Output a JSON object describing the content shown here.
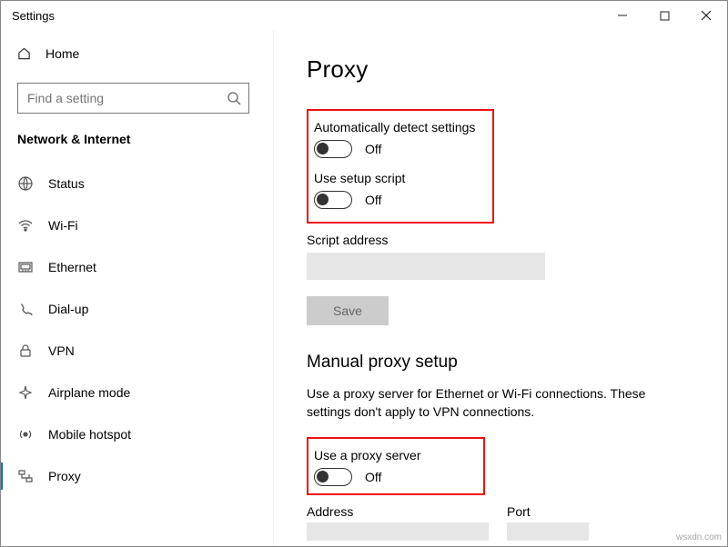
{
  "window": {
    "title": "Settings"
  },
  "sidebar": {
    "home": "Home",
    "search_placeholder": "Find a setting",
    "header": "Network & Internet",
    "items": [
      {
        "label": "Status"
      },
      {
        "label": "Wi-Fi"
      },
      {
        "label": "Ethernet"
      },
      {
        "label": "Dial-up"
      },
      {
        "label": "VPN"
      },
      {
        "label": "Airplane mode"
      },
      {
        "label": "Mobile hotspot"
      },
      {
        "label": "Proxy"
      }
    ]
  },
  "page": {
    "title": "Proxy",
    "auto_label": "Automatically detect settings",
    "auto_state": "Off",
    "script_label": "Use setup script",
    "script_state": "Off",
    "script_addr_label": "Script address",
    "save": "Save",
    "manual_title": "Manual proxy setup",
    "manual_desc": "Use a proxy server for Ethernet or Wi-Fi connections. These settings don't apply to VPN connections.",
    "use_proxy_label": "Use a proxy server",
    "use_proxy_state": "Off",
    "addr_label": "Address",
    "port_label": "Port"
  },
  "watermark": "wsxdn.com"
}
